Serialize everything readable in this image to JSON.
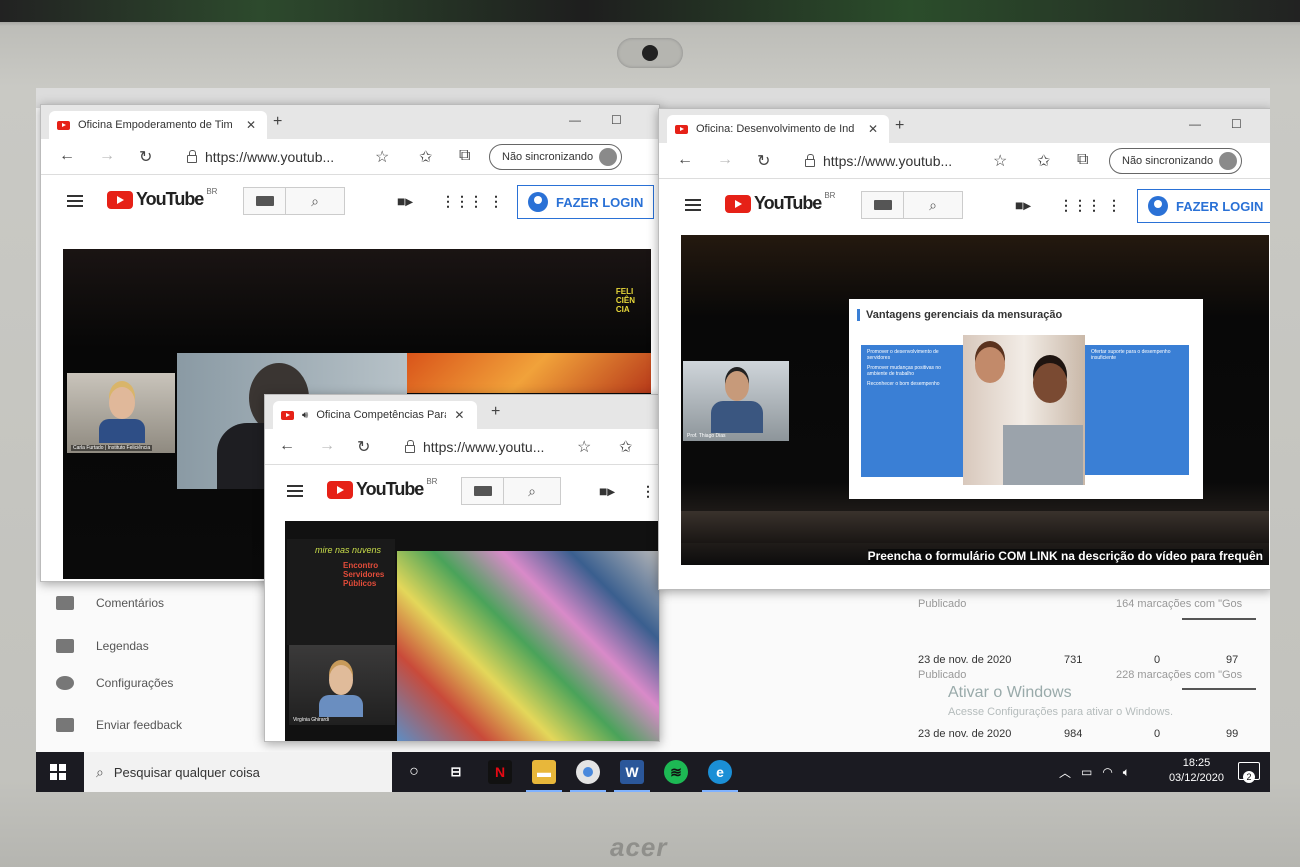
{
  "background_page": {
    "menu": [
      {
        "icon": "comment-icon",
        "label": "Comentários"
      },
      {
        "icon": "subtitles-icon",
        "label": "Legendas"
      },
      {
        "icon": "gear-icon",
        "label": "Configurações"
      },
      {
        "icon": "feedback-icon",
        "label": "Enviar feedback"
      }
    ],
    "stats": [
      {
        "date": "",
        "published": "Publicado",
        "marks": "164 marcações com \"Gos"
      },
      {
        "date": "23 de nov. de 2020",
        "a": "731",
        "b": "0",
        "c": "97",
        "published": "Publicado",
        "marks": "228 marcações com \"Gos"
      },
      {
        "date": "23 de nov. de 2020",
        "a": "984",
        "b": "0",
        "c": "99"
      }
    ],
    "activate_title": "Ativar o Windows",
    "activate_sub": "Acesse Configurações para ativar o Windows."
  },
  "window1": {
    "tab_title": "Oficina Empoderamento de Tim",
    "url": "https://www.youtub...",
    "sync_label": "Não sincronizando",
    "login_label": "FAZER LOGIN",
    "video": {
      "brand": "FELI\nCIÊN\nCIA",
      "speaker": "Carla Furtado | Instituto Feliciência"
    }
  },
  "window2": {
    "tab_title": "Oficina: Desenvolvimento de Ind",
    "url": "https://www.youtub...",
    "sync_label": "Não sincronizando",
    "login_label": "FAZER LOGIN",
    "video": {
      "slide_title": "Vantagens gerenciais da mensuração",
      "bullets_left": [
        "Promover o desenvolvimento de servidores",
        "Promover mudanças positivas no ambiente de trabalho",
        "Reconhecer o bom desempenho"
      ],
      "bullet_right": "Ofertar suporte para o desempenho insuficiente",
      "speaker": "Prof. Thiago Dias",
      "ticker": "Preencha o formulário COM LINK na descrição do vídeo para frequên"
    }
  },
  "window3": {
    "tab_title": "Oficina Competências Para",
    "url": "https://www.youtu...",
    "video": {
      "event_tag": "mire nas nuvens",
      "event_name": "Encontro Servidores Públicos",
      "speaker": "Virgínia Ghirardi"
    }
  },
  "youtube_logo_text": "YouTube",
  "youtube_region": "BR",
  "taskbar": {
    "search_placeholder": "Pesquisar qualquer coisa",
    "time": "18:25",
    "date": "03/12/2020",
    "notifications": "2"
  },
  "brand": "acer",
  "colors": {
    "youtube_red": "#e62117",
    "login_blue": "#2a71d6",
    "taskbar": "#1b1b22",
    "slide_blue": "#3a7fd5"
  }
}
